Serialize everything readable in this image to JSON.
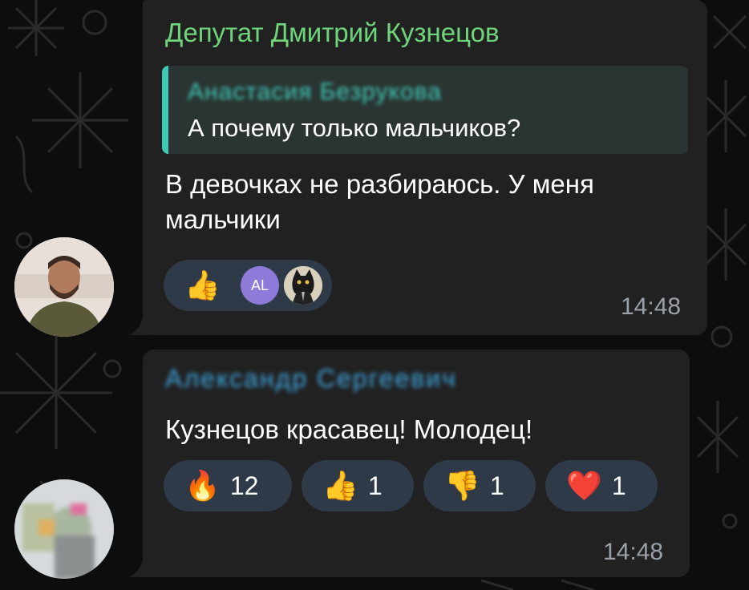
{
  "messages": [
    {
      "sender": "Депутат Дмитрий Кузнецов",
      "reply": {
        "author": "Анастасия Безрукова",
        "text": "А почему только мальчиков?"
      },
      "text_line1": "В девочках не разбираюсь. У меня",
      "text_line2": "мальчики",
      "reaction": {
        "emoji": "👍",
        "user_initials": "AL"
      },
      "time": "14:48"
    },
    {
      "sender": "Александр Сергеевич",
      "text": "Кузнецов красавец! Молодец!",
      "reactions": [
        {
          "emoji": "🔥",
          "count": "12"
        },
        {
          "emoji": "👍",
          "count": "1"
        },
        {
          "emoji": "👎",
          "count": "1"
        },
        {
          "emoji": "❤️",
          "count": "1"
        }
      ],
      "time": "14:48"
    }
  ],
  "colors": {
    "background": "#0d0d0e",
    "bubble": "#212121",
    "sender_name": "#6ed57a",
    "quote_accent": "#40c9b6",
    "reaction_bg": "#2e3a48",
    "time": "#9aa1a8"
  }
}
